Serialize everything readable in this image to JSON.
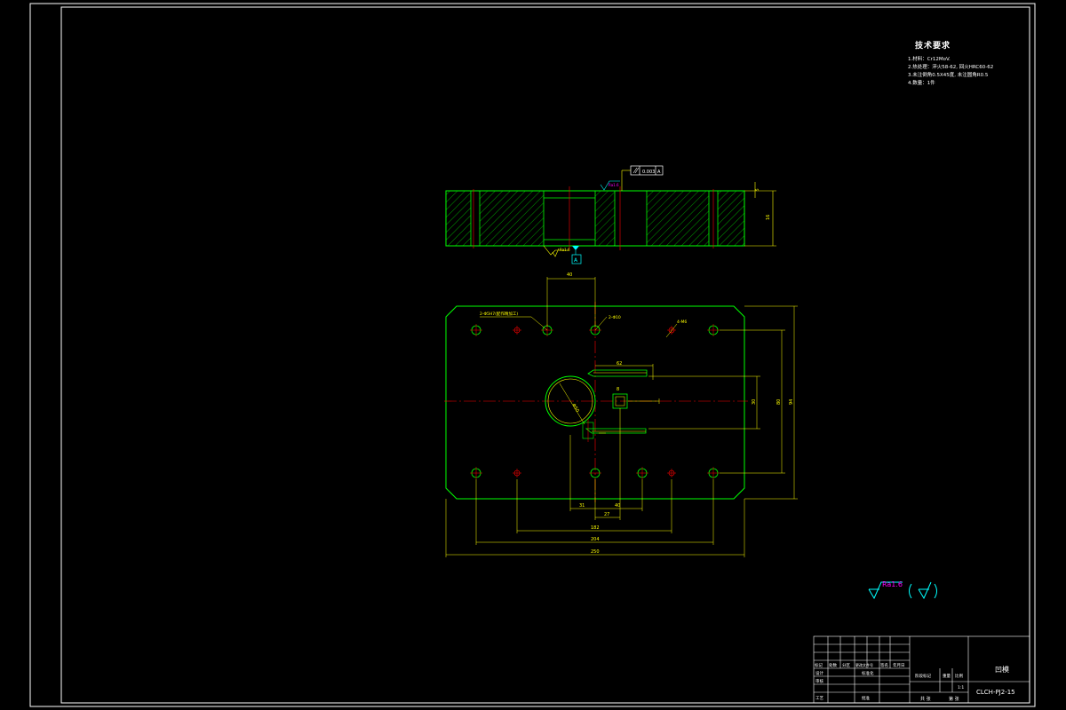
{
  "technical_requirements": {
    "title": "技术要求",
    "lines": [
      "1.材料：Cr12MoV.",
      "2.热处理：淬火58-62, 回火HRC60-62",
      "3.未注倒角0.5X45度, 未注圆角R0.5",
      "4.数量：1件"
    ]
  },
  "annotations": {
    "roughness_symbol": "Ra1.6",
    "parallelism_tolerance": "0.003",
    "datum_label": "A",
    "hole_callout_1": "2-Φ5H7(配作精加工)",
    "hole_callout_2": "2-Φ10",
    "hole_callout_3": "4-M6",
    "section_thickness": "16",
    "section_thickness_top": "5"
  },
  "dimensions": {
    "top_width": "40",
    "slot_length": "62",
    "slot_height": "30",
    "plate_height_inner": "80",
    "plate_height_outer": "94",
    "bottom_dim_1": "31",
    "bottom_dim_2": "27",
    "bottom_dim_3": "40",
    "bottom_dim_4": "182",
    "bottom_dim_5": "204",
    "bottom_dim_6": "250",
    "circle_dia": "Φ50",
    "small_dim": "8"
  },
  "title_block": {
    "part_name": "凹模",
    "drawing_number": "CLCH-PJ2-15",
    "scale": "1:1",
    "labels": [
      "标记",
      "处数",
      "分区",
      "更改文件号",
      "签名",
      "年月日"
    ],
    "design_label": "设计",
    "check_label": "审核",
    "process_label": "工艺",
    "standard_label": "标准化",
    "approve_label": "批准",
    "stage_label": "阶段标记",
    "weight_label": "重量",
    "ratio_label": "比例",
    "sheet_total": "共 张",
    "sheet_num": "第 张"
  },
  "colors": {
    "outline": "#00ff00",
    "dimension": "#ffff00",
    "centerline": "#ff0000",
    "frame": "#ffffff",
    "datum": "#00ffff",
    "roughness_text": "#ff00ff"
  }
}
